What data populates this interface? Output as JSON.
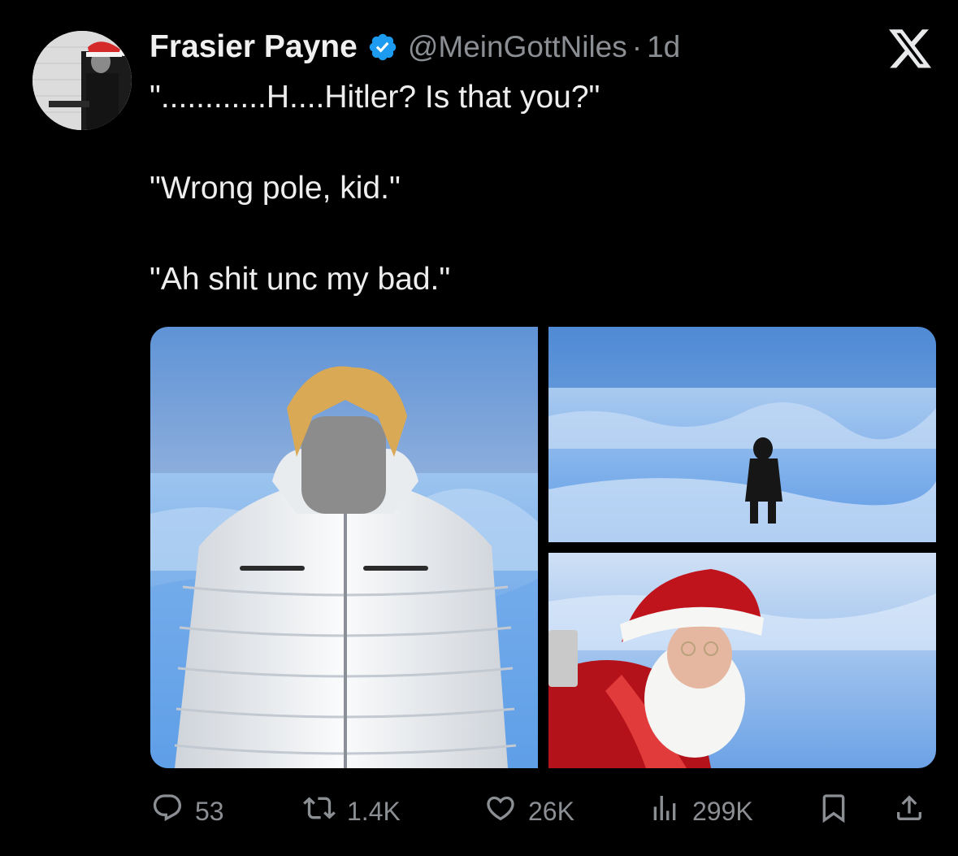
{
  "author": {
    "display_name": "Frasier Payne",
    "handle": "@MeinGottNiles",
    "separator": "·",
    "time": "1d",
    "verified": true
  },
  "tweet": {
    "lines": [
      "\"............H....Hitler? Is that you?\"",
      "\"Wrong pole, kid.\"",
      "\"Ah shit unc my bad.\""
    ]
  },
  "media": {
    "panels": [
      {
        "name": "man-in-white-puffer-jacket"
      },
      {
        "name": "figure-walking-on-ice"
      },
      {
        "name": "santa-claus-in-snow"
      }
    ]
  },
  "actions": {
    "replies": "53",
    "reposts": "1.4K",
    "likes": "26K",
    "views": "299K"
  },
  "icons": {
    "reply": "reply-icon",
    "repost": "repost-icon",
    "like": "heart-icon",
    "views": "views-icon",
    "bookmark": "bookmark-icon",
    "share": "share-icon",
    "platform": "x-logo-icon",
    "verified": "verified-badge-icon"
  },
  "colors": {
    "background": "#000000",
    "text": "#e7e9ea",
    "muted": "#8b8f94",
    "verified": "#1d9bf0"
  }
}
